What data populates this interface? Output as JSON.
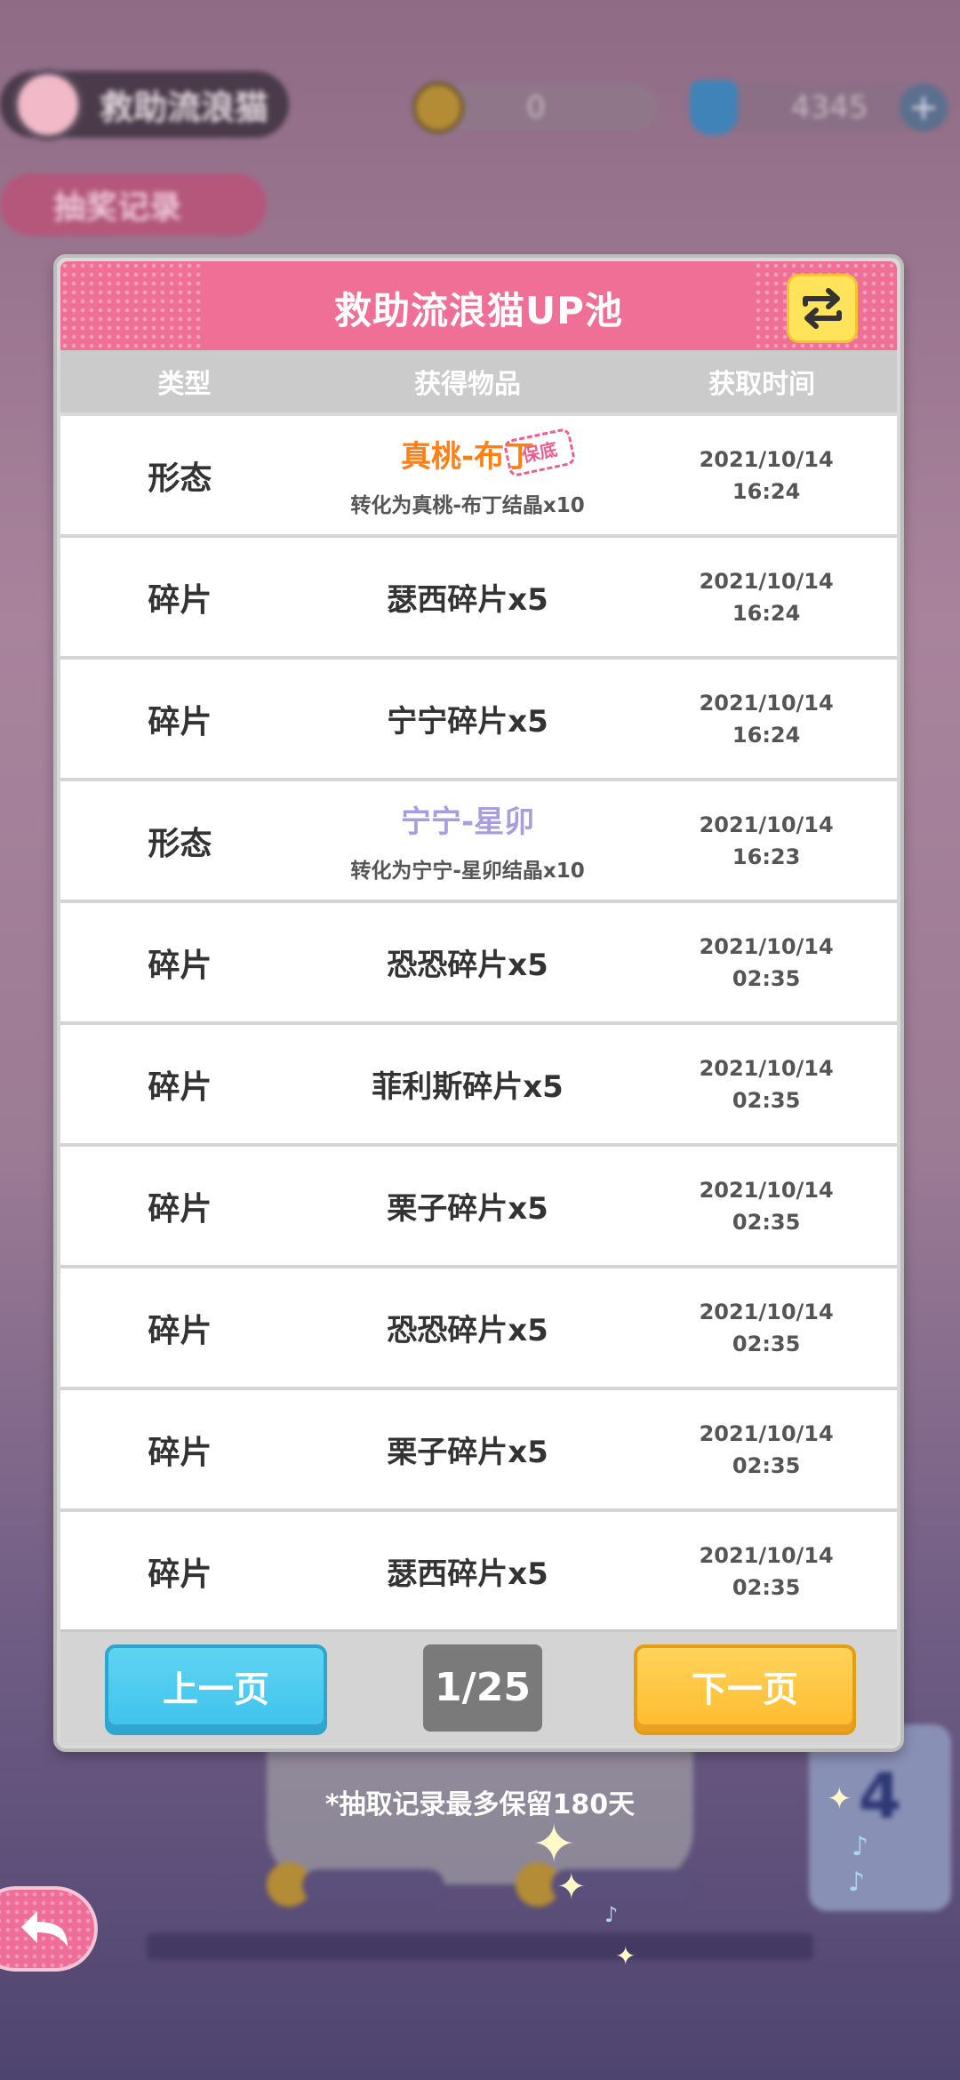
{
  "hud": {
    "event_name": "救助流浪猫",
    "coins": "0",
    "gems": "4345",
    "record_tab": "抽奖记录"
  },
  "background": {
    "card_number": "4"
  },
  "dialog": {
    "title": "救助流浪猫UP池",
    "columns": {
      "type": "类型",
      "item": "获得物品",
      "time": "获取时间"
    },
    "rows": [
      {
        "type": "形态",
        "item": "真桃-布丁",
        "sub": "转化为真桃-布丁结晶x10",
        "badge": "保底",
        "date": "2021/10/14",
        "clock": "16:24"
      },
      {
        "type": "碎片",
        "item": "瑟西碎片x5",
        "date": "2021/10/14",
        "clock": "16:24"
      },
      {
        "type": "碎片",
        "item": "宁宁碎片x5",
        "date": "2021/10/14",
        "clock": "16:24"
      },
      {
        "type": "形态",
        "item": "宁宁-星卯",
        "sub": "转化为宁宁-星卯结晶x10",
        "date": "2021/10/14",
        "clock": "16:23"
      },
      {
        "type": "碎片",
        "item": "恐恐碎片x5",
        "date": "2021/10/14",
        "clock": "02:35"
      },
      {
        "type": "碎片",
        "item": "菲利斯碎片x5",
        "date": "2021/10/14",
        "clock": "02:35"
      },
      {
        "type": "碎片",
        "item": "栗子碎片x5",
        "date": "2021/10/14",
        "clock": "02:35"
      },
      {
        "type": "碎片",
        "item": "恐恐碎片x5",
        "date": "2021/10/14",
        "clock": "02:35"
      },
      {
        "type": "碎片",
        "item": "栗子碎片x5",
        "date": "2021/10/14",
        "clock": "02:35"
      },
      {
        "type": "碎片",
        "item": "瑟西碎片x5",
        "date": "2021/10/14",
        "clock": "02:35"
      }
    ],
    "pager": {
      "prev": "上一页",
      "page": "1/25",
      "next": "下一页"
    }
  },
  "notice": "*抽取记录最多保留180天",
  "colors": {
    "header_pink": "#f06f97",
    "highlight_orange": "#ff7f13",
    "highlight_purple": "#a99de0",
    "prev_blue": "#3ec2ec",
    "next_yellow": "#ffbb2e"
  },
  "icons": {
    "swap": "swap-arrows-icon",
    "back": "back-arrow-icon"
  }
}
